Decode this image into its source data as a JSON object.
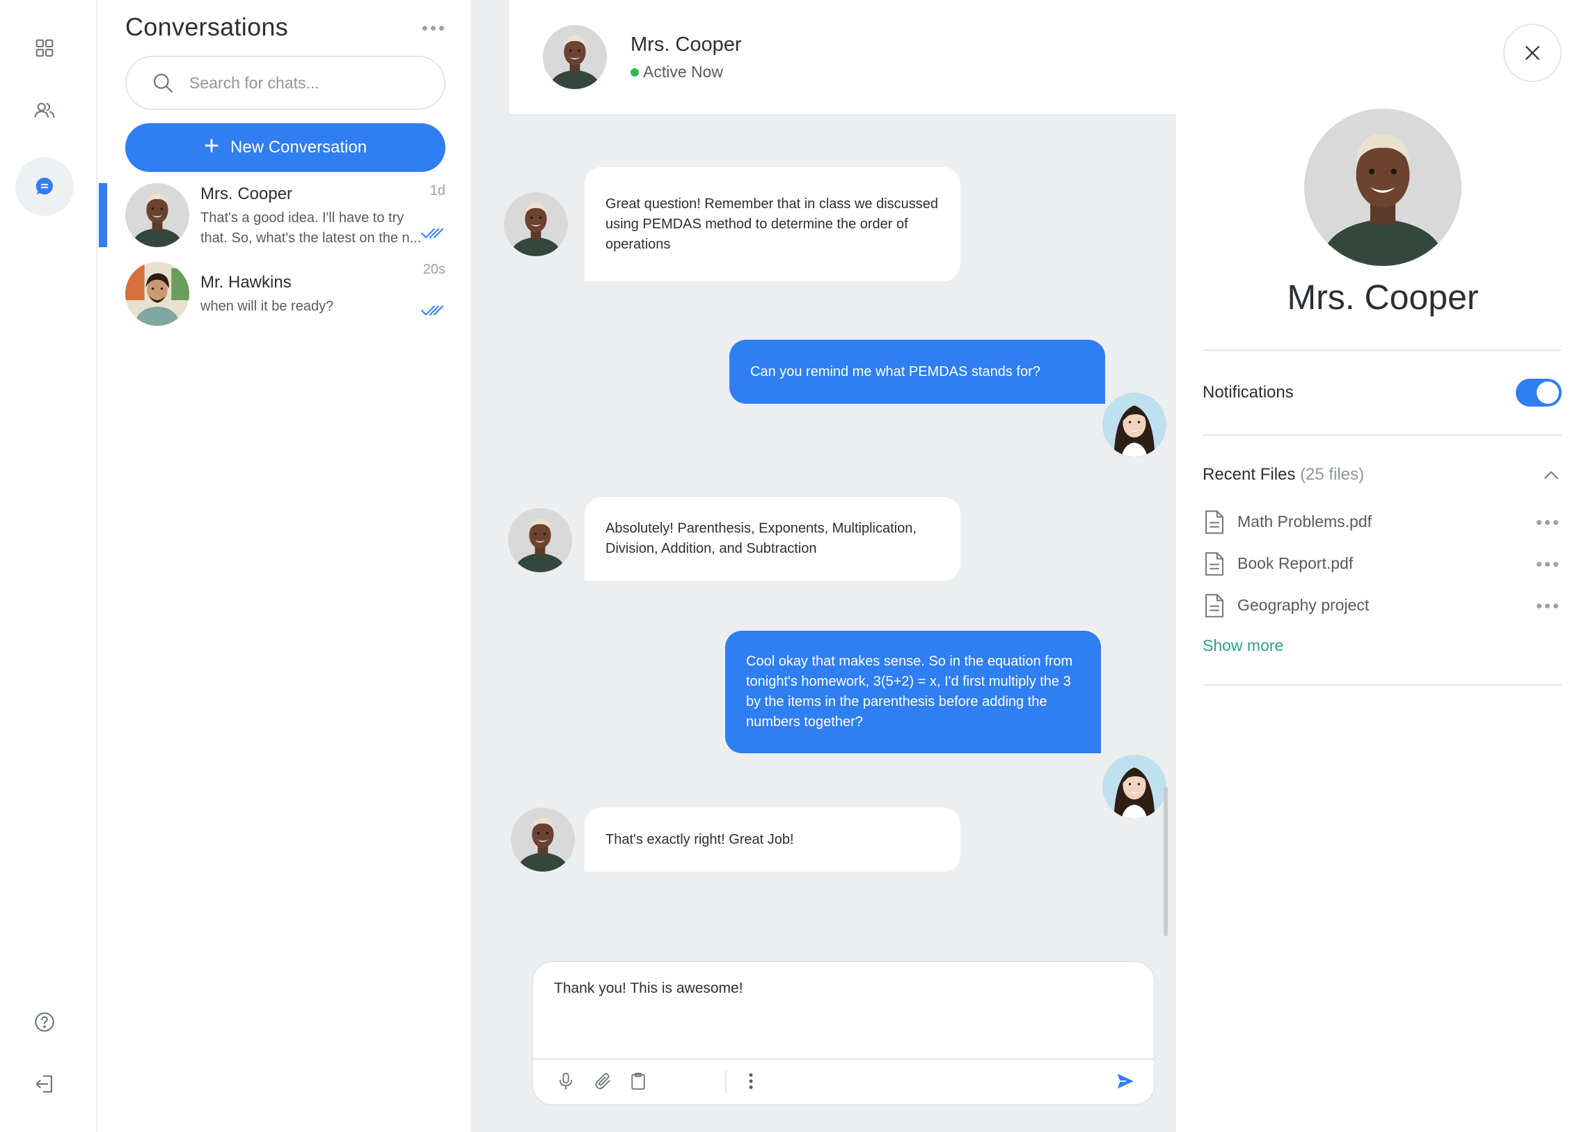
{
  "rail": {
    "items": [
      {
        "icon": "grid-icon"
      },
      {
        "icon": "users-icon"
      },
      {
        "icon": "chat-icon",
        "active": true
      }
    ],
    "bottom": [
      {
        "icon": "help-icon"
      },
      {
        "icon": "logout-icon"
      }
    ]
  },
  "conversations": {
    "title": "Conversations",
    "search_placeholder": "Search for chats...",
    "new_label": "New Conversation",
    "items": [
      {
        "name": "Mrs. Cooper",
        "time": "1d",
        "preview": "That's a good idea. I'll have to try that. So, what's the latest on the n...",
        "active": true
      },
      {
        "name": "Mr. Hawkins",
        "time": "20s",
        "preview": "when will it be ready?",
        "active": false
      }
    ]
  },
  "chat": {
    "contact_name": "Mrs. Cooper",
    "status": "Active Now",
    "messages": [
      {
        "from": "them",
        "text": "Great question! Remember that in class we discussed using PEMDAS method to determine the order of operations"
      },
      {
        "from": "me",
        "text": "Can you remind me what PEMDAS stands for?"
      },
      {
        "from": "them",
        "text": "Absolutely! Parenthesis, Exponents, Multiplication, Division, Addition, and Subtraction"
      },
      {
        "from": "me",
        "text": "Cool okay that makes sense. So in the equation from tonight's homework, 3(5+2) = x, I'd first multiply the 3 by the items in the parenthesis before adding the numbers together?"
      },
      {
        "from": "them",
        "text": "That's exactly right! Great Job!"
      }
    ],
    "draft": "Thank you! This is awesome!"
  },
  "details": {
    "name": "Mrs. Cooper",
    "notifications_label": "Notifications",
    "notifications_on": true,
    "files_label": "Recent Files",
    "files_count": "(25 files)",
    "files": [
      {
        "name": "Math Problems.pdf"
      },
      {
        "name": "Book Report.pdf"
      },
      {
        "name": "Geography project"
      }
    ],
    "show_more": "Show more"
  },
  "colors": {
    "accent": "#2f7ef2",
    "online": "#2dbb4e",
    "link": "#2f9e8f"
  }
}
